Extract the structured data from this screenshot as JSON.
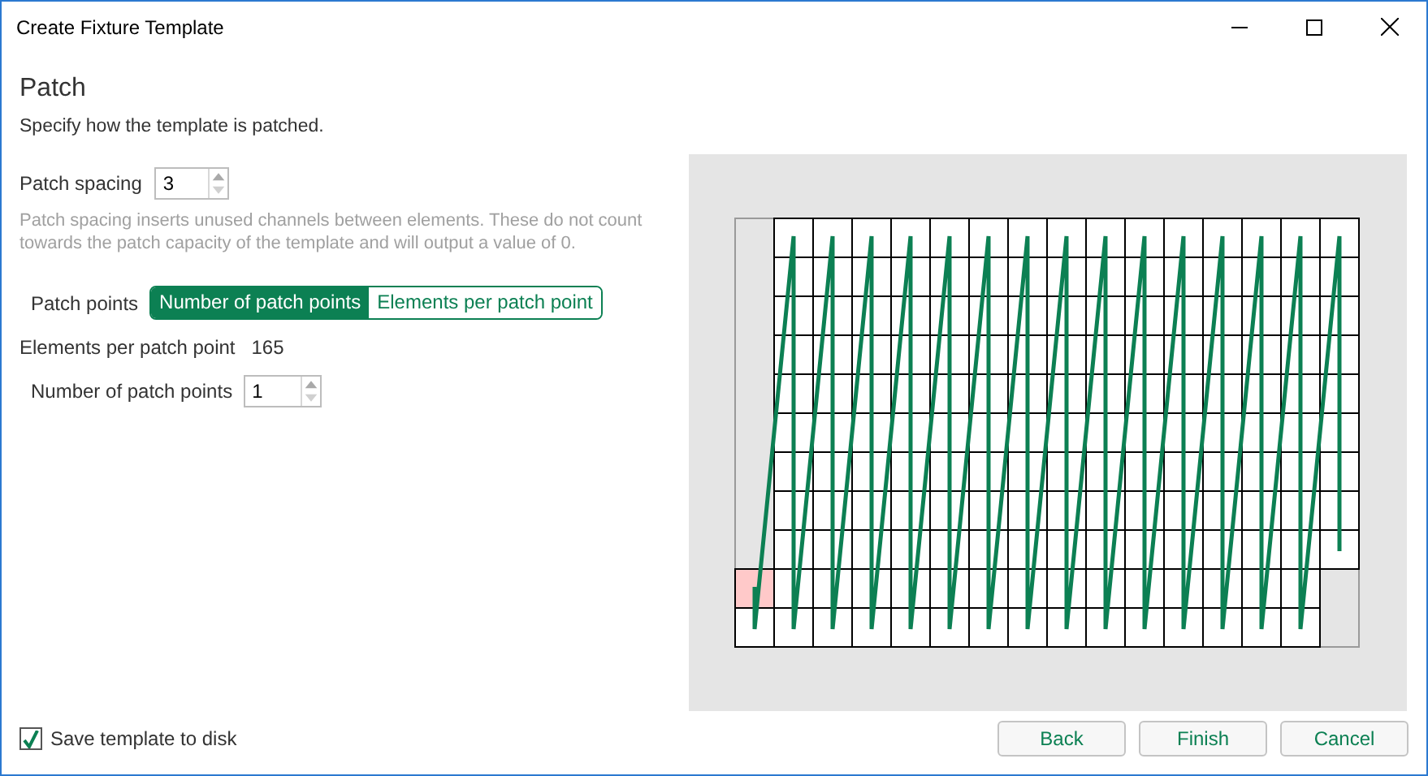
{
  "window": {
    "title": "Create Fixture Template"
  },
  "page": {
    "heading": "Patch",
    "subtitle": "Specify how the template is patched."
  },
  "patch_spacing": {
    "label": "Patch spacing",
    "value": "3",
    "hint": "Patch spacing inserts unused channels between elements. These do not count towards the patch capacity of the template and will output a value of 0."
  },
  "patch_points": {
    "label": "Patch points",
    "options": [
      {
        "label": "Number of patch points",
        "selected": true
      },
      {
        "label": "Elements per patch point",
        "selected": false
      }
    ]
  },
  "elements_per_patch_point": {
    "label": "Elements per patch point",
    "value": "165"
  },
  "number_of_patch_points": {
    "label": "Number of patch points",
    "value": "1"
  },
  "save_template": {
    "label": "Save template to disk",
    "checked": true
  },
  "buttons": [
    "Back",
    "Finish",
    "Cancel"
  ]
}
